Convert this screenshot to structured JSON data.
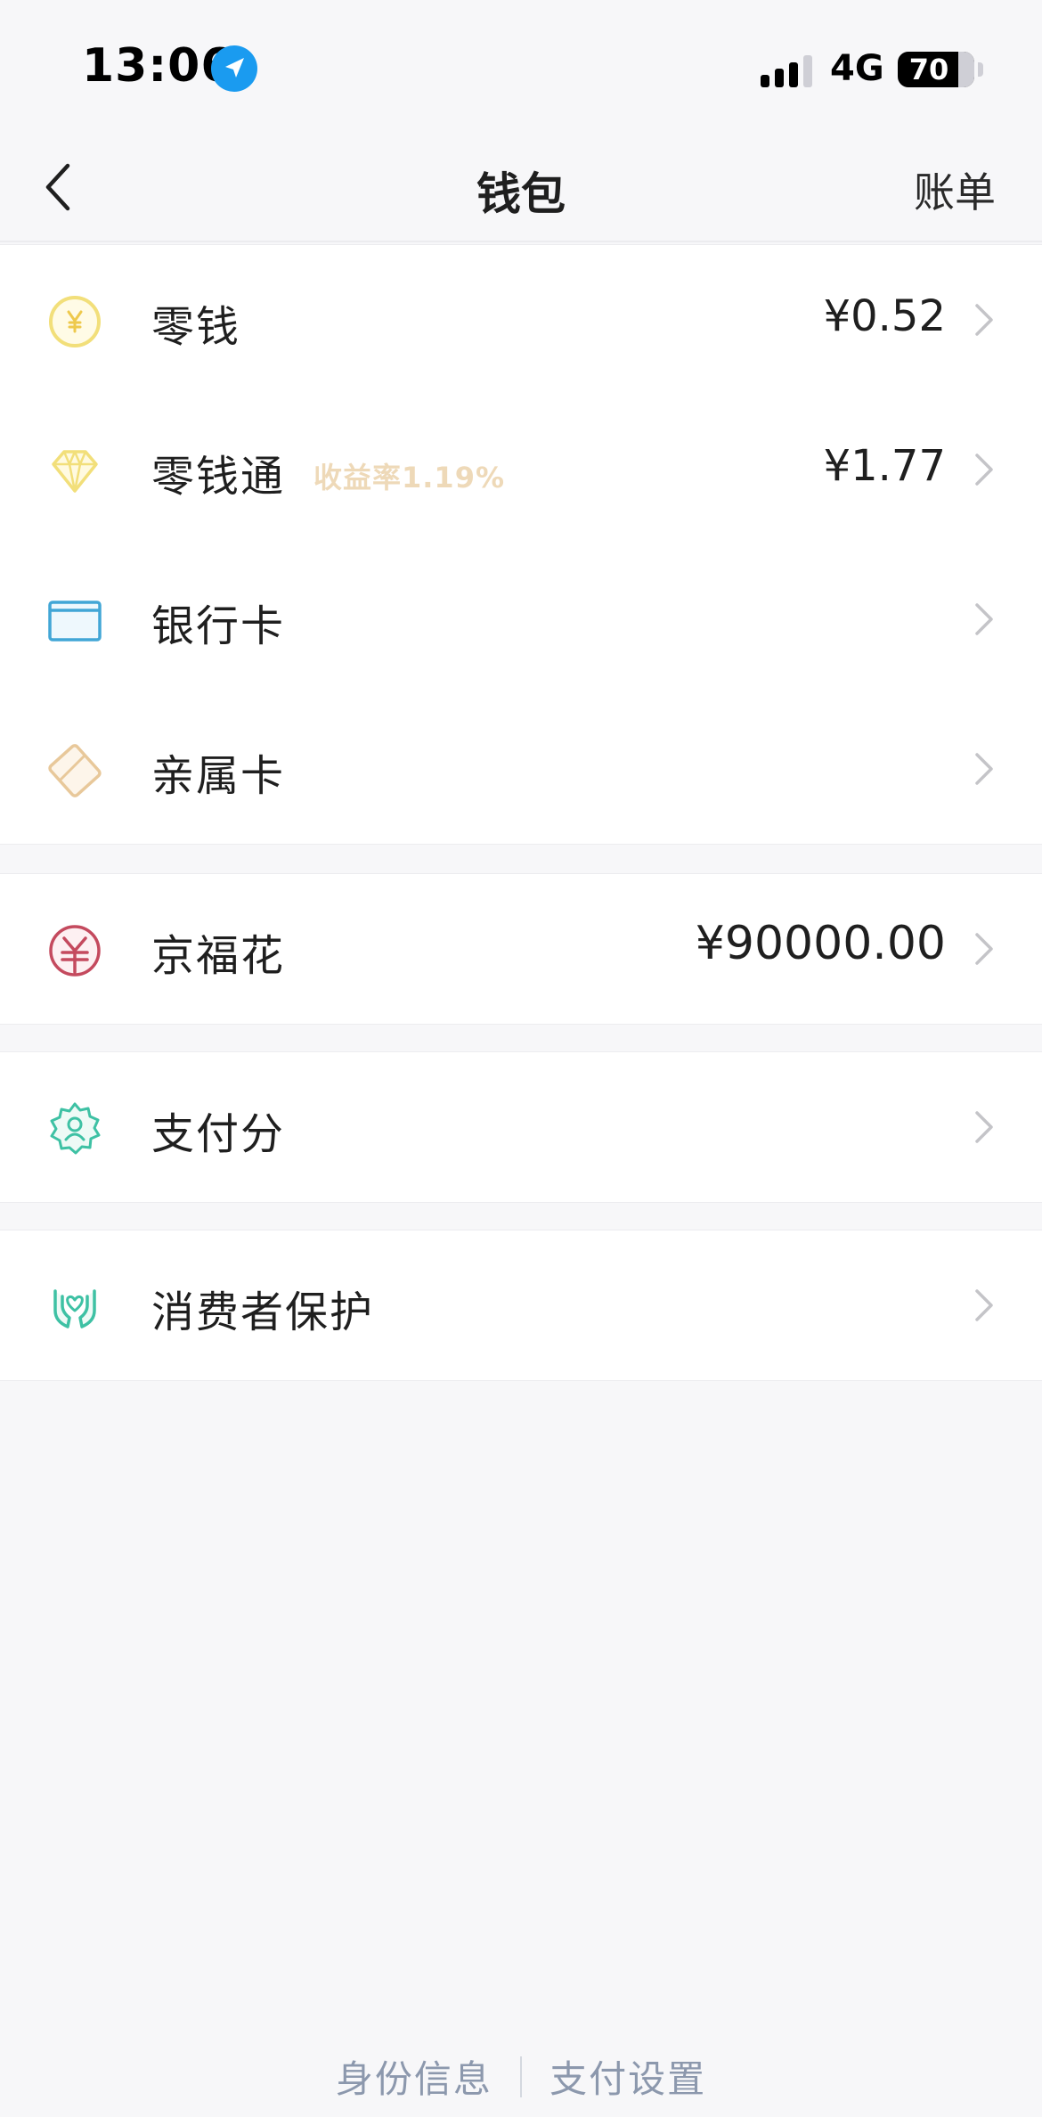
{
  "status_bar": {
    "time": "13:06",
    "network": "4G",
    "battery": "70",
    "battery_level": 0.7,
    "location_icon": "location-arrow-icon",
    "accent": "#1a9bf0"
  },
  "nav": {
    "title": "钱包",
    "right_action": "账单",
    "back_icon": "chevron-left-icon"
  },
  "groups": [
    {
      "rows": [
        {
          "icon": "coin-yen-icon",
          "label": "零钱",
          "value": "¥0.52"
        },
        {
          "icon": "diamond-icon",
          "label": "零钱通",
          "badge": "收益率1.19%",
          "value": "¥1.77"
        },
        {
          "icon": "bank-card-icon",
          "label": "银行卡",
          "value": ""
        },
        {
          "icon": "family-card-icon",
          "label": "亲属卡",
          "value": ""
        }
      ]
    },
    {
      "rows": [
        {
          "icon": "jingfuhua-yen-icon",
          "label": "京福花",
          "value": "¥90000.00"
        }
      ]
    },
    {
      "rows": [
        {
          "icon": "pay-score-badge-icon",
          "label": "支付分",
          "value": ""
        }
      ]
    },
    {
      "rows": [
        {
          "icon": "consumer-protection-hands-icon",
          "label": "消费者保护",
          "value": ""
        }
      ]
    }
  ],
  "footer": {
    "identity": "身份信息",
    "pay_settings": "支付设置"
  },
  "colors": {
    "background": "#f7f7f9",
    "badge": "#eed9b8",
    "footer_link": "#8c98ad",
    "coin": "#f2df7a",
    "card": "#41a6d6",
    "family": "#e8c89a",
    "jingfuhua": "#c44a5e",
    "teal": "#3ec1a4"
  }
}
